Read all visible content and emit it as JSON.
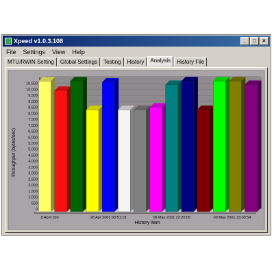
{
  "window": {
    "title": "Xpeed v1.0.3.108",
    "minimize_glyph": "_",
    "maximize_glyph": "□",
    "close_glyph": "×"
  },
  "menu": [
    {
      "label": "File"
    },
    {
      "label": "Settings"
    },
    {
      "label": "View"
    },
    {
      "label": "Help"
    }
  ],
  "tabs": [
    {
      "label": "MTU/RWIN Setting",
      "active": false
    },
    {
      "label": "Global Settings",
      "active": false
    },
    {
      "label": "Testing",
      "active": false
    },
    {
      "label": "History",
      "active": false
    },
    {
      "label": "Analysis",
      "active": true
    },
    {
      "label": "History File",
      "active": false
    }
  ],
  "chart_data": {
    "type": "bar",
    "ylabel": "Throughput (bytes/sec)",
    "xlabel": "History Item",
    "ylim": [
      0,
      11000
    ],
    "yticks": [
      0,
      500,
      1000,
      1500,
      2000,
      2500,
      3000,
      3500,
      4000,
      4500,
      5000,
      5500,
      6000,
      6500,
      7000,
      7500,
      8000,
      8500,
      9000,
      9500,
      10000,
      10500
    ],
    "ytick_labels": [
      "0",
      "500",
      "1,000",
      "1,500",
      "2,000",
      "2,500",
      "3,000",
      "3,500",
      "4,000",
      "4,500",
      "5,000",
      "5,500",
      "6,000",
      "6,500",
      "7,000",
      "7,500",
      "8,000",
      "8,500",
      "9,000",
      "9,500",
      "10,000",
      "10,500"
    ],
    "xtick_labels": [
      {
        "index": 0,
        "text": "8 April 100"
      },
      {
        "index": 4,
        "text": "28 Apr 2001 00:51:18"
      },
      {
        "index": 8,
        "text": "09 May 2001 22:20:05"
      },
      {
        "index": 13,
        "text": "09 May 2001 23:03:54"
      }
    ],
    "bars": [
      {
        "value": 10700,
        "color": "#ffff66"
      },
      {
        "value": 9900,
        "color": "#ff1010"
      },
      {
        "value": 10700,
        "color": "#006400"
      },
      {
        "value": 8300,
        "color": "#ffff00"
      },
      {
        "value": 10600,
        "color": "#0000ff"
      },
      {
        "value": 8300,
        "color": "#f4f4f4"
      },
      {
        "value": 8300,
        "color": "#808080"
      },
      {
        "value": 8500,
        "color": "#ff00ff"
      },
      {
        "value": 10400,
        "color": "#008080"
      },
      {
        "value": 10700,
        "color": "#000080"
      },
      {
        "value": 8300,
        "color": "#800000"
      },
      {
        "value": 10700,
        "color": "#00ff00"
      },
      {
        "value": 10700,
        "color": "#808000"
      },
      {
        "value": 10400,
        "color": "#800080"
      }
    ]
  }
}
